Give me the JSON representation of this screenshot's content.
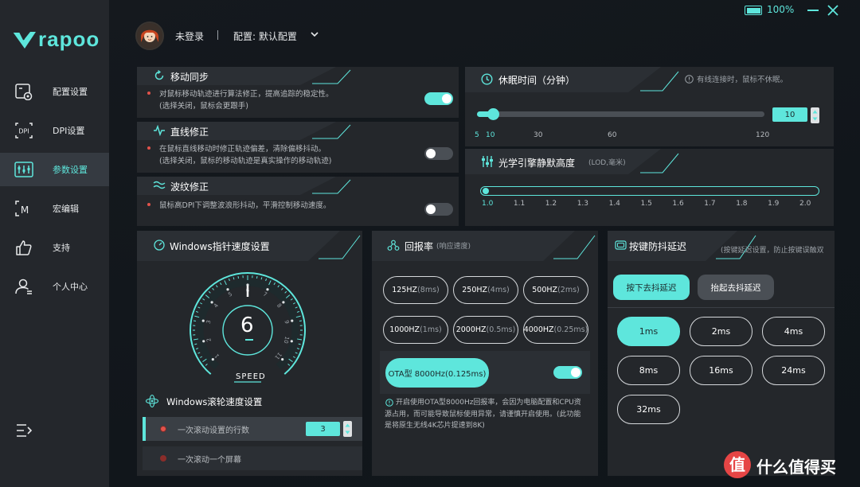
{
  "app": {
    "brand": "rapoo",
    "battery": "100%"
  },
  "header": {
    "user": "未登录",
    "config": "配置: 默认配置"
  },
  "sidebar": {
    "items": [
      {
        "label": "配置设置",
        "icon": "config-icon"
      },
      {
        "label": "DPI设置",
        "icon": "dpi-icon"
      },
      {
        "label": "参数设置",
        "icon": "params-icon"
      },
      {
        "label": "宏编辑",
        "icon": "macro-icon"
      },
      {
        "label": "支持",
        "icon": "thumbs-up-icon"
      },
      {
        "label": "个人中心",
        "icon": "user-icon"
      }
    ],
    "active": 2
  },
  "motion_sync": {
    "title": "移动同步",
    "desc1": "对鼠标移动轨迹进行算法修正，提高追踪的稳定性。",
    "desc2": "(选择关闭，鼠标会更跟手)",
    "enabled": true
  },
  "angle_snap": {
    "title": "直线修正",
    "desc1": "在鼠标直线移动时修正轨迹偏差，清除偏移抖动。",
    "desc2": "(选择关闭，鼠标的移动轨迹是真实操作的移动轨迹)",
    "enabled": false
  },
  "ripple": {
    "title": "波纹修正",
    "desc1": "鼠标高DPI下调整波浪形抖动，平滑控制移动速度。",
    "enabled": false
  },
  "sleep": {
    "title": "休眠时间（分钟）",
    "hint": "有线连接时，鼠标不休眠。",
    "value": "10",
    "ticks": [
      "5",
      "10",
      "30",
      "60",
      "120"
    ],
    "min": 5,
    "max": 120
  },
  "lod": {
    "title": "光学引擎静默高度",
    "unit": "(LOD,毫米)",
    "ticks": [
      "1.0",
      "1.1",
      "1.2",
      "1.3",
      "1.4",
      "1.5",
      "1.6",
      "1.7",
      "1.8",
      "1.9",
      "2.0"
    ],
    "value": 1.0
  },
  "pointer": {
    "title": "Windows指针速度设置",
    "value": "6",
    "label": "SPEED",
    "dial": [
      "1",
      "2",
      "3",
      "4",
      "5",
      "6",
      "7",
      "8",
      "9",
      "10",
      "11"
    ]
  },
  "wheel": {
    "title": "Windows滚轮速度设置",
    "opt1": "一次滚动设置的行数",
    "opt1_value": "3",
    "opt2": "一次滚动一个屏幕"
  },
  "polling": {
    "title": "回报率",
    "subtitle": "(响应速度)",
    "rates": [
      {
        "main": "125HZ",
        "sub": "(8ms)"
      },
      {
        "main": "250HZ",
        "sub": "(4ms)"
      },
      {
        "main": "500HZ",
        "sub": "(2ms)"
      },
      {
        "main": "1000HZ",
        "sub": "(1ms)"
      },
      {
        "main": "2000HZ",
        "sub": "(0.5ms)"
      },
      {
        "main": "4000HZ",
        "sub": "(0.25ms)"
      }
    ],
    "ota_label": "OTA型 8000Hz(0.125ms)",
    "ota_enabled": true,
    "ota_note": "开启使用OTA型8000Hz回报率，会因为电脑配置和CPU资源占用，而可能导致鼠标使用异常，请谨慎开启使用。(此功能是将原生无线4K芯片提速到8K)"
  },
  "debounce": {
    "title": "按键防抖延迟",
    "hint": "(按键延迟设置，防止按键误触双",
    "tab_press": "按下去抖延迟",
    "tab_release": "抬起去抖延迟",
    "options": [
      "1ms",
      "2ms",
      "4ms",
      "8ms",
      "16ms",
      "24ms",
      "32ms"
    ],
    "selected": 0
  },
  "watermark": "什么值得买",
  "colors": {
    "accent": "#5ee6dc",
    "bg": "#15181d",
    "panel": "#24272b",
    "warn_dot": "#e2534b"
  }
}
